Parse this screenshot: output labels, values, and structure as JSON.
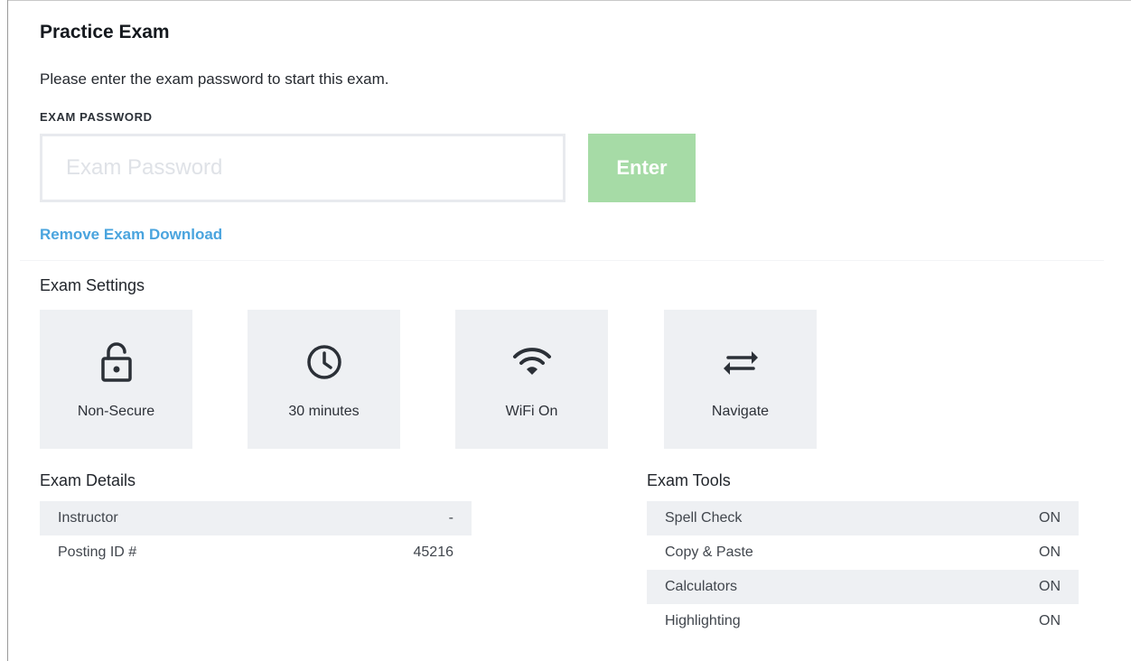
{
  "title": "Practice Exam",
  "instructions": "Please enter the exam password to start this exam.",
  "password": {
    "label": "EXAM PASSWORD",
    "placeholder": "Exam Password",
    "value": ""
  },
  "enter_button": "Enter",
  "remove_link": "Remove Exam Download",
  "settings": {
    "heading": "Exam Settings",
    "tiles": [
      {
        "icon": "unlock-icon",
        "label": "Non-Secure"
      },
      {
        "icon": "clock-icon",
        "label": "30 minutes"
      },
      {
        "icon": "wifi-icon",
        "label": "WiFi On"
      },
      {
        "icon": "swap-arrows-icon",
        "label": "Navigate"
      }
    ]
  },
  "details": {
    "heading": "Exam Details",
    "rows": [
      {
        "label": "Instructor",
        "value": "-"
      },
      {
        "label": "Posting ID #",
        "value": "45216"
      }
    ]
  },
  "tools": {
    "heading": "Exam Tools",
    "rows": [
      {
        "label": "Spell Check",
        "value": "ON"
      },
      {
        "label": "Copy & Paste",
        "value": "ON"
      },
      {
        "label": "Calculators",
        "value": "ON"
      },
      {
        "label": "Highlighting",
        "value": "ON"
      }
    ]
  },
  "colors": {
    "accent_link": "#4aa4de",
    "enter_button_bg": "#a6dba6",
    "tile_bg": "#eef0f3"
  }
}
